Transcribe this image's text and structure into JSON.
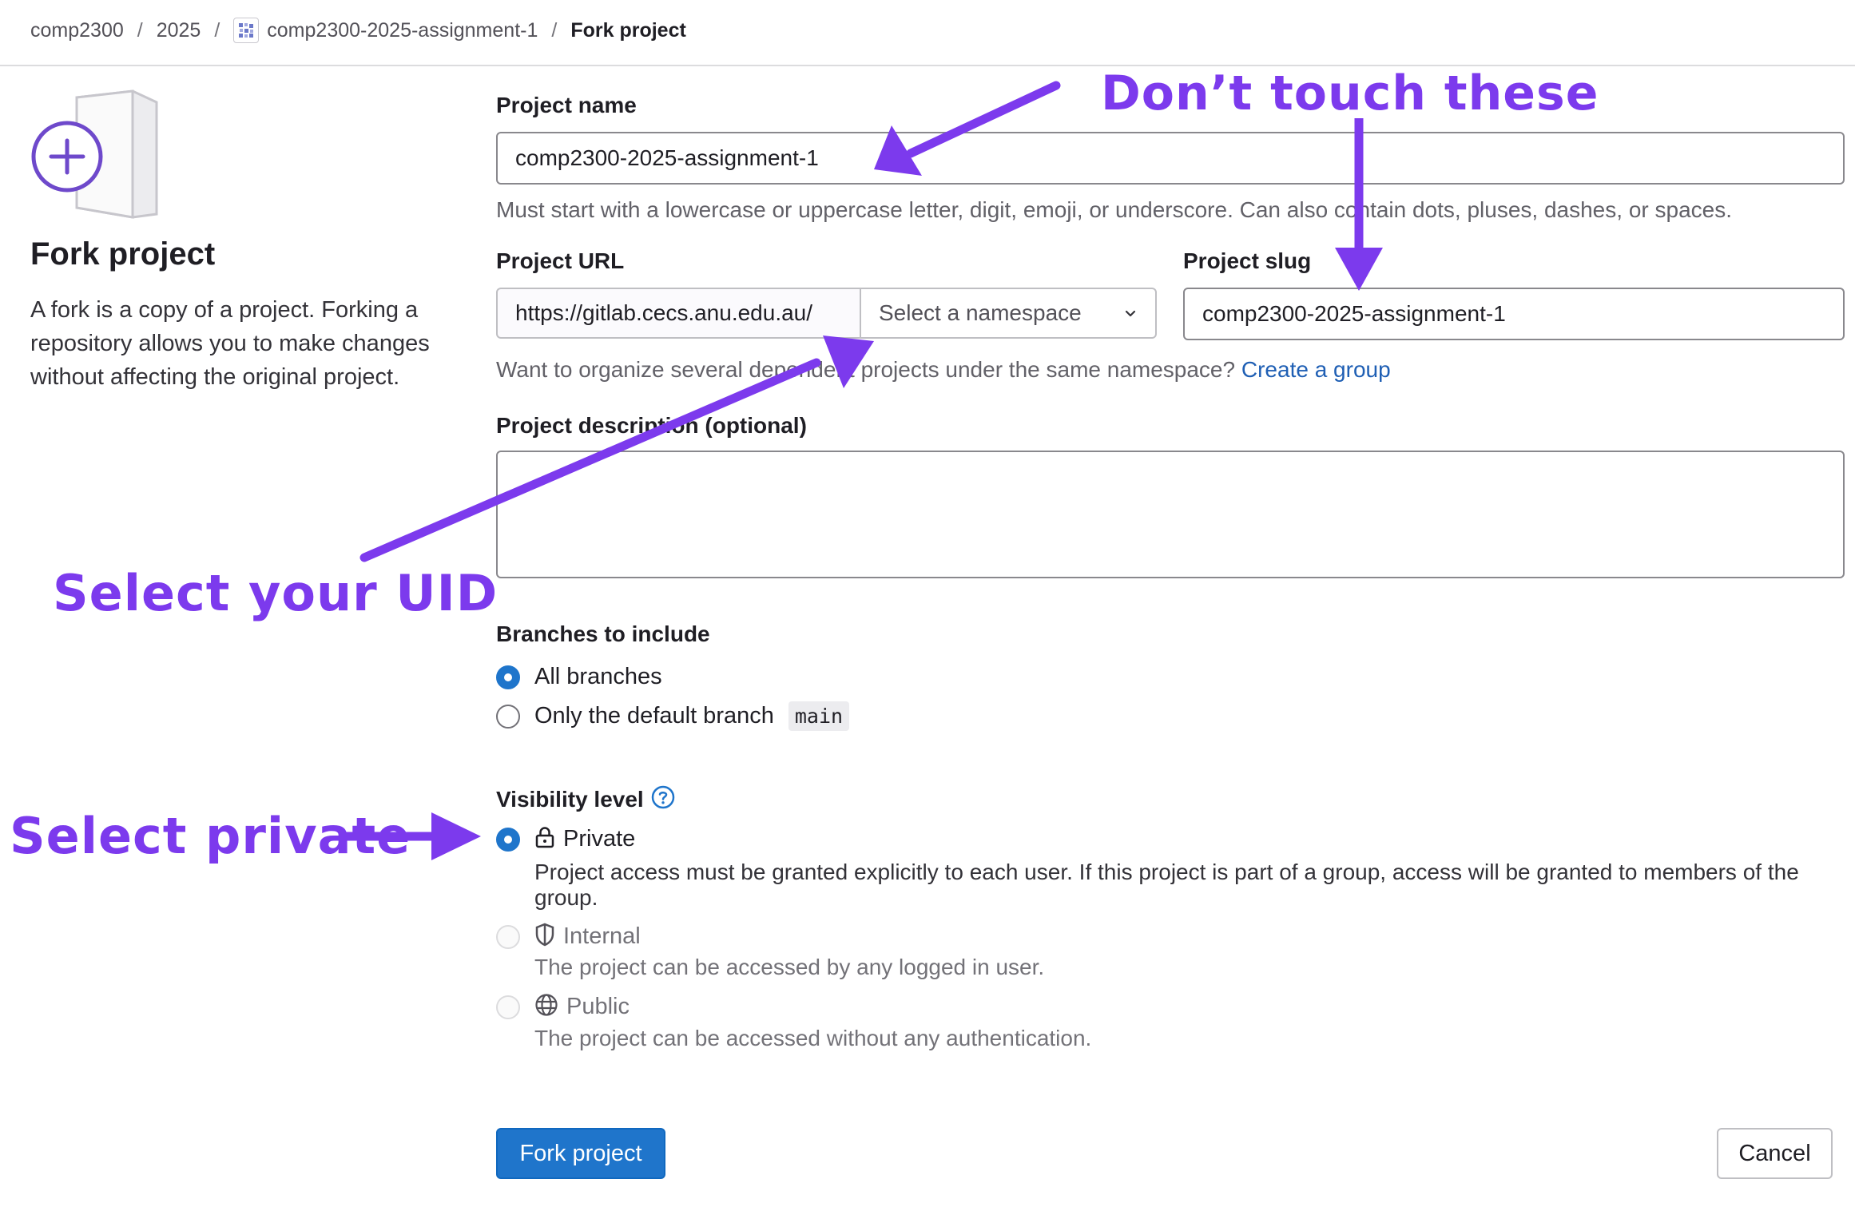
{
  "breadcrumb": {
    "items": [
      "comp2300",
      "2025",
      "comp2300-2025-assignment-1",
      "Fork project"
    ],
    "separator": "/"
  },
  "sidebar": {
    "title": "Fork project",
    "description": "A fork is a copy of a project. Forking a repository allows you to make changes without affecting the original project."
  },
  "form": {
    "project_name": {
      "label": "Project name",
      "value": "comp2300-2025-assignment-1",
      "help": "Must start with a lowercase or uppercase letter, digit, emoji, or underscore. Can also contain dots, pluses, dashes, or spaces."
    },
    "project_url": {
      "label": "Project URL",
      "prefix": "https://gitlab.cecs.anu.edu.au/",
      "namespace_placeholder": "Select a namespace"
    },
    "project_slug": {
      "label": "Project slug",
      "value": "comp2300-2025-assignment-1"
    },
    "namespace_help": {
      "text": "Want to organize several dependent projects under the same namespace?",
      "link": "Create a group"
    },
    "description": {
      "label": "Project description (optional)",
      "value": ""
    },
    "branches": {
      "label": "Branches to include",
      "options": [
        {
          "label": "All branches",
          "selected": true
        },
        {
          "label": "Only the default branch",
          "selected": false,
          "code": "main"
        }
      ]
    },
    "visibility": {
      "label": "Visibility level",
      "options": [
        {
          "label": "Private",
          "icon": "lock-icon",
          "selected": true,
          "disabled": false,
          "description": "Project access must be granted explicitly to each user. If this project is part of a group, access will be granted to members of the group."
        },
        {
          "label": "Internal",
          "icon": "shield-icon",
          "selected": false,
          "disabled": true,
          "description": "The project can be accessed by any logged in user."
        },
        {
          "label": "Public",
          "icon": "globe-icon",
          "selected": false,
          "disabled": true,
          "description": "The project can be accessed without any authentication."
        }
      ]
    },
    "submit_label": "Fork project",
    "cancel_label": "Cancel"
  },
  "annotations": {
    "dont_touch": "Don’t touch these",
    "select_uid": "Select your UID",
    "select_private": "Select private",
    "color": "#7c3aed"
  },
  "colors": {
    "primary": "#1f75cb",
    "link": "#1f5fb4",
    "annotation": "#7c3aed"
  }
}
